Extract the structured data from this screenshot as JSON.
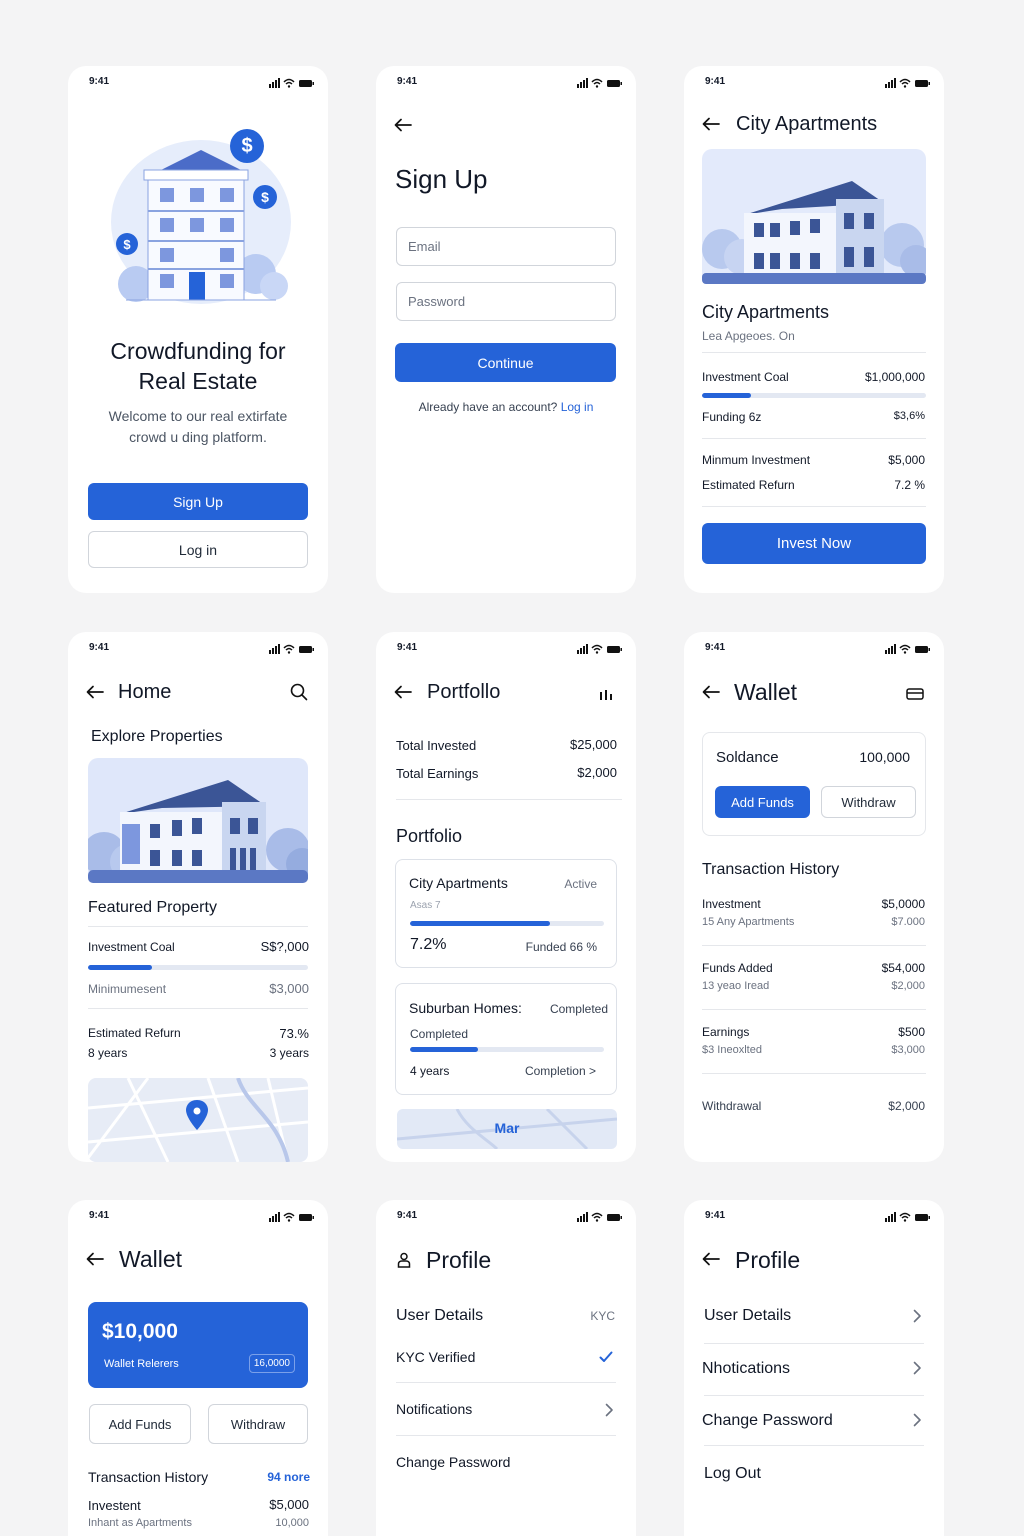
{
  "status_time": "9:41",
  "colors": {
    "primary": "#2563d8",
    "illustration_light": "#dce6fa",
    "illustration_dark": "#3b5596"
  },
  "welcome": {
    "title_line1": "Crowdfunding for",
    "title_line2": "Real Estate",
    "sub_line1": "Welcome to our real extirfate",
    "sub_line2": "crowd u ding platform.",
    "signup_label": "Sign Up",
    "login_label": "Log in",
    "dollar_symbol": "$"
  },
  "signup": {
    "title": "Sign Up",
    "email_placeholder": "Email",
    "password_placeholder": "Password",
    "continue_label": "Continue",
    "have_account": "Already have an account?",
    "login_link": "Log in"
  },
  "detail": {
    "header_title": "City Apartments",
    "name": "City Apartments",
    "location": "Lea Apgeoes. On",
    "investment_label": "Investment Coal",
    "investment_value": "$1,000,000",
    "progress": 0.22,
    "funding_label": "Funding 6z",
    "funding_value": "$3,6%",
    "min_label": "Minmum Investment",
    "min_value": "$5,000",
    "return_label": "Estimated Refurn",
    "return_value": "7.2 %",
    "invest_label": "Invest Now"
  },
  "home": {
    "title": "Home",
    "section_title": "Explore Properties",
    "featured_title": "Featured Property",
    "investment_label": "Investment Coal",
    "investment_value": "S$?,000",
    "progress": 0.29,
    "min_label": "Minimumesent",
    "min_value": "$3,000",
    "return_label": "Estimated Refurn",
    "return_value": "73.%",
    "years_left": "8 years",
    "years_right": "3 years"
  },
  "portfolio": {
    "title": "Portfollo",
    "total_invested_label": "Total Invested",
    "total_invested_value": "$25,000",
    "total_earnings_label": "Total Earnings",
    "total_earnings_value": "$2,000",
    "section_title": "Portfolio",
    "card1": {
      "name": "City Apartments",
      "status": "Active",
      "sub": "Asas 7",
      "progress": 0.72,
      "return": "7.2%",
      "funded": "Funded 66 %"
    },
    "card2": {
      "name": "Suburban Homes:",
      "status": "Completed",
      "sub": "Completed",
      "progress": 0.35,
      "years": "4 years",
      "completion": "Completion >"
    },
    "map_label": "Mar"
  },
  "wallet1": {
    "title": "Wallet",
    "balance_label": "Soldance",
    "balance_value": "100,000",
    "add_funds": "Add Funds",
    "withdraw": "Withdraw",
    "history_title": "Transaction History",
    "transactions": [
      {
        "title": "Investment",
        "sub": "15 Any Apartments",
        "amount": "$5,0000",
        "sub_amount": "$7.000"
      },
      {
        "title": "Funds Added",
        "sub": "13 yeao Iread",
        "amount": "$54,000",
        "sub_amount": "$2,000"
      },
      {
        "title": "Earnings",
        "sub": "$3 Ineoxlted",
        "amount": "$500",
        "sub_amount": "$3,000"
      },
      {
        "title": "Withdrawal",
        "sub": "",
        "amount": "$2,000",
        "sub_amount": ""
      }
    ]
  },
  "wallet2": {
    "title": "Wallet",
    "balance": "$10,000",
    "card_label": "Wallet Relerers",
    "card_badge": "16,0000",
    "add_funds": "Add Funds",
    "withdraw": "Withdraw",
    "history_title": "Transaction History",
    "see_more": "94 nore",
    "tx_title": "Investent",
    "tx_sub": "Inhant as Apartments",
    "tx_amount": "$5,000",
    "tx_sub_amount": "10,000"
  },
  "profile1": {
    "title": "Profile",
    "user_details": "User Details",
    "kyc_tag": "KYC",
    "kyc_verified": "KYC Verified",
    "notifications": "Notifications",
    "change_password": "Change Password"
  },
  "profile2": {
    "title": "Profile",
    "items": [
      "User Details",
      "Nhotications",
      "Change Password",
      "Log Out"
    ]
  }
}
